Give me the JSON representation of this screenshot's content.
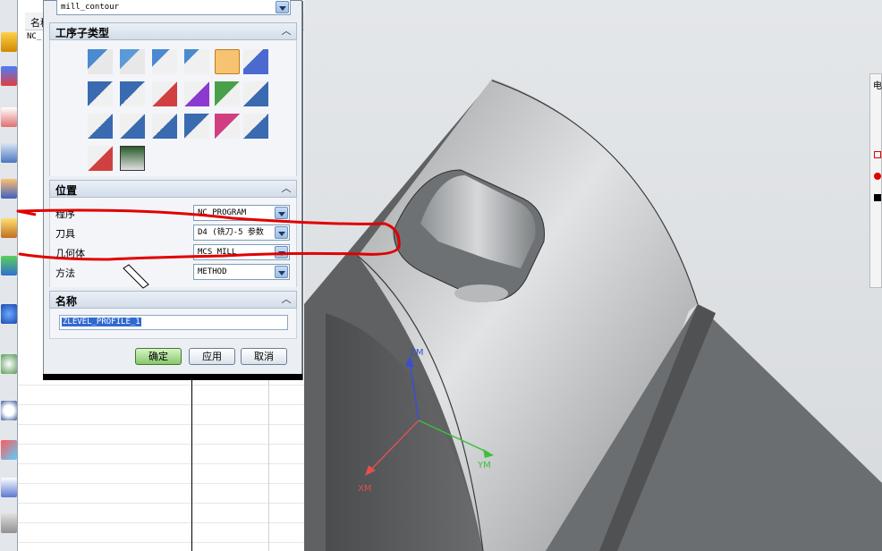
{
  "navigator": {
    "header_label": "名称",
    "root_label": "NC_"
  },
  "dialog": {
    "type_value": "mill_contour",
    "subtype_section_title": "工序子类型",
    "position_section_title": "位置",
    "name_section_title": "名称",
    "position_fields": [
      {
        "label": "程序",
        "value": "NC_PROGRAM"
      },
      {
        "label": "刀具",
        "value": "D4 (铣刀-5 参数"
      },
      {
        "label": "几何体",
        "value": "MCS_MILL"
      },
      {
        "label": "方法",
        "value": "METHOD"
      }
    ],
    "name_value": "ZLEVEL_PROFILE_1",
    "buttons": {
      "ok": "确定",
      "apply": "应用",
      "cancel": "取消"
    }
  },
  "viewport": {
    "axis_labels": {
      "zm": "ZM",
      "xm": "XM",
      "ym": "YM"
    },
    "right_panel_label": "电"
  },
  "colors": {
    "annotation_red": "#e00000",
    "selected_icon": "#f6c470",
    "axis_z": "#3a4fd0",
    "axis_x": "#e05050",
    "axis_y": "#3cbf3c"
  }
}
